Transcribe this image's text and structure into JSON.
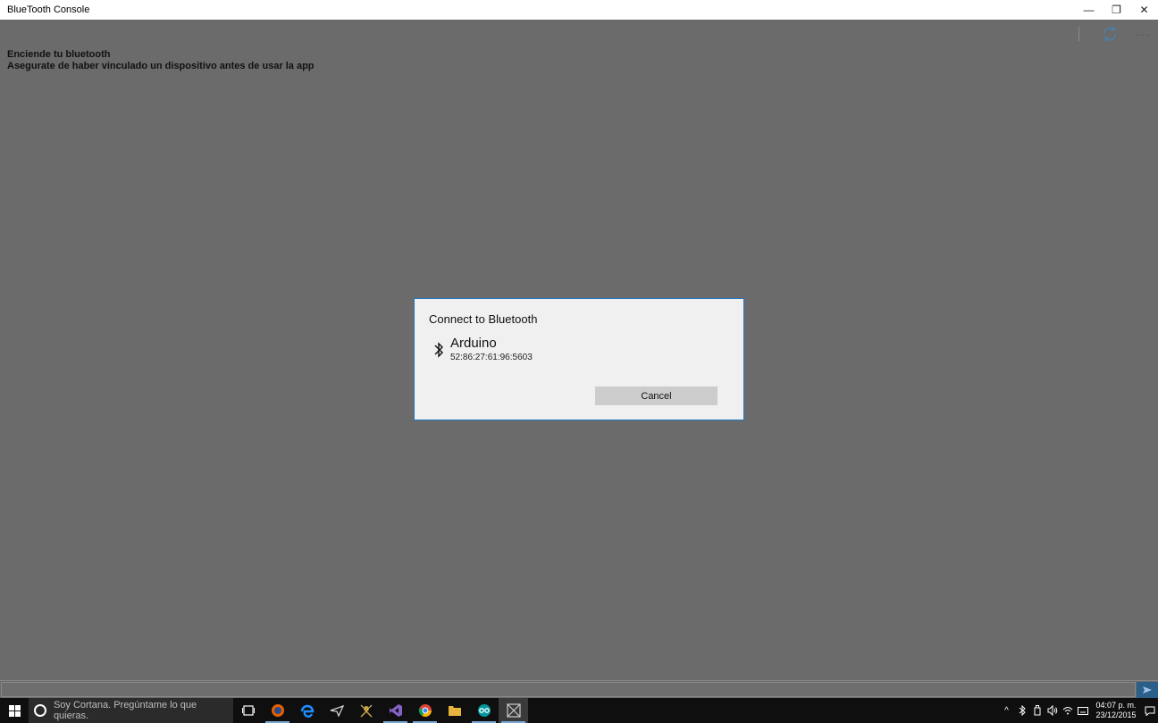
{
  "window": {
    "title": "BlueTooth Console",
    "minimize_label": "—",
    "restore_label": "❐",
    "close_label": "✕"
  },
  "commandbar": {
    "refresh_icon": "refresh-icon",
    "more_label": "···"
  },
  "messages": [
    "Enciende tu bluetooth",
    "Asegurate de haber vinculado un dispositivo antes de usar la app"
  ],
  "dialog": {
    "title": "Connect to Bluetooth",
    "device_name": "Arduino",
    "device_address": "52:86:27:61:96:5603",
    "cancel_label": "Cancel"
  },
  "input": {
    "value": ""
  },
  "taskbar": {
    "cortana_placeholder": "Soy Cortana. Pregúntame lo que quieras.",
    "apps": [
      "task-view",
      "firefox",
      "edge",
      "app-3",
      "app-4",
      "visual-studio",
      "chrome",
      "file-explorer",
      "arduino",
      "bluetooth-console"
    ],
    "tray_chevron": "^",
    "time": "04:07 p. m.",
    "date": "23/12/2015"
  },
  "colors": {
    "accent": "#1e78c8",
    "app_background": "#6b6b6b",
    "taskbar": "#0f0f0f"
  }
}
